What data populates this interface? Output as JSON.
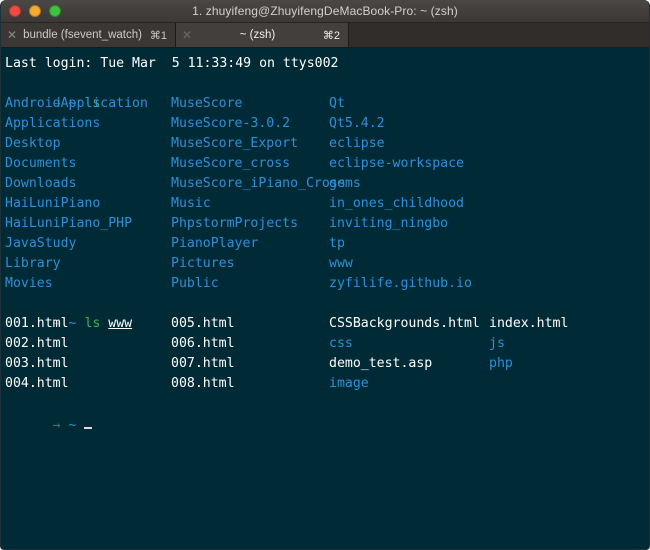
{
  "window": {
    "title": "1. zhuyifeng@ZhuyifengDeMacBook-Pro: ~ (zsh)",
    "traffic_lights": {
      "close_label": "close",
      "minimize_label": "minimize",
      "maximize_label": "maximize",
      "close_color": "#f04b42",
      "minimize_color": "#f5ab31",
      "maximize_color": "#3fc23f"
    },
    "titlebar_bg": "#3b3836"
  },
  "tabs": [
    {
      "close_glyph": "✕",
      "label": "bundle (fsevent_watch)",
      "shortcut": "⌘1",
      "active": false
    },
    {
      "close_glyph": "✕",
      "label": "~ (zsh)",
      "shortcut": "⌘2",
      "active": true
    }
  ],
  "terminal": {
    "background": "#002b36",
    "foreground": "#ffffff",
    "dir_color": "#2f8fd8",
    "cmd_color": "#3bb74b",
    "arrow_color": "#4e6a6f",
    "login_line": "Last login: Tue Mar  5 11:33:49 on ttys002",
    "prompt": {
      "arrow": "→",
      "path": "~"
    },
    "command_1": "ls",
    "command_2": "ls",
    "command_2_arg": "www",
    "cursor": "_",
    "ls_home": {
      "rows": [
        {
          "c1": "AndroidApplication",
          "c1_type": "dir",
          "c2": "MuseScore",
          "c2_type": "dir",
          "c3": "Qt",
          "c3_type": "dir"
        },
        {
          "c1": "Applications",
          "c1_type": "dir",
          "c2": "MuseScore-3.0.2",
          "c2_type": "dir",
          "c3": "Qt5.4.2",
          "c3_type": "dir"
        },
        {
          "c1": "Desktop",
          "c1_type": "dir",
          "c2": "MuseScore_Export",
          "c2_type": "dir",
          "c3": "eclipse",
          "c3_type": "dir"
        },
        {
          "c1": "Documents",
          "c1_type": "dir",
          "c2": "MuseScore_cross",
          "c2_type": "dir",
          "c3": "eclipse-workspace",
          "c3_type": "dir"
        },
        {
          "c1": "Downloads",
          "c1_type": "dir",
          "c2": "MuseScore_iPiano_Cross",
          "c2_type": "dir",
          "c3": "gems",
          "c3_type": "dir"
        },
        {
          "c1": "HaiLuniPiano",
          "c1_type": "dir",
          "c2": "Music",
          "c2_type": "dir",
          "c3": "in_ones_childhood",
          "c3_type": "dir"
        },
        {
          "c1": "HaiLuniPiano_PHP",
          "c1_type": "dir",
          "c2": "PhpstormProjects",
          "c2_type": "dir",
          "c3": "inviting_ningbo",
          "c3_type": "dir"
        },
        {
          "c1": "JavaStudy",
          "c1_type": "dir",
          "c2": "PianoPlayer",
          "c2_type": "dir",
          "c3": "tp",
          "c3_type": "dir"
        },
        {
          "c1": "Library",
          "c1_type": "dir",
          "c2": "Pictures",
          "c2_type": "dir",
          "c3": "www",
          "c3_type": "dir"
        },
        {
          "c1": "Movies",
          "c1_type": "dir",
          "c2": "Public",
          "c2_type": "dir",
          "c3": "zyfilife.github.io",
          "c3_type": "dir"
        }
      ]
    },
    "ls_www": {
      "rows": [
        {
          "c1": "001.html",
          "c1_type": "file",
          "c2": "005.html",
          "c2_type": "file",
          "c3": "CSSBackgrounds.html",
          "c3_type": "file",
          "c4": "index.html",
          "c4_type": "file"
        },
        {
          "c1": "002.html",
          "c1_type": "file",
          "c2": "006.html",
          "c2_type": "file",
          "c3": "css",
          "c3_type": "dir",
          "c4": "js",
          "c4_type": "dir"
        },
        {
          "c1": "003.html",
          "c1_type": "file",
          "c2": "007.html",
          "c2_type": "file",
          "c3": "demo_test.asp",
          "c3_type": "file",
          "c4": "php",
          "c4_type": "dir"
        },
        {
          "c1": "004.html",
          "c1_type": "file",
          "c2": "008.html",
          "c2_type": "file",
          "c3": "image",
          "c3_type": "dir",
          "c4": "",
          "c4_type": "file"
        }
      ]
    }
  }
}
